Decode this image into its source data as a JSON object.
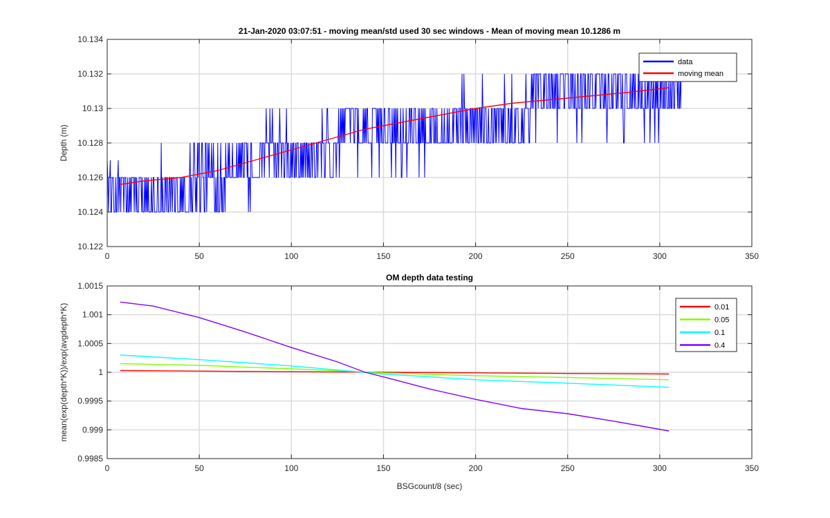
{
  "colors": {
    "data": "#0000ff",
    "moving_mean": "#ff0000",
    "k_0_01": "#ff0000",
    "k_0_05": "#80ff00",
    "k_0_1": "#00ffff",
    "k_0_4": "#8000ff"
  },
  "chart_data": [
    {
      "type": "line",
      "title": "21-Jan-2020 03:07:51 - moving mean/std used 30 sec windows - Mean of moving mean 10.1286 m",
      "xlabel": "",
      "ylabel": "Depth (m)",
      "xlim": [
        0,
        350
      ],
      "ylim": [
        10.122,
        10.134
      ],
      "xticks": [
        0,
        50,
        100,
        150,
        200,
        250,
        300,
        350
      ],
      "xtick_labels": [
        "0",
        "50",
        "100",
        "150",
        "200",
        "250",
        "300",
        "350"
      ],
      "yticks": [
        10.122,
        10.124,
        10.126,
        10.128,
        10.13,
        10.132,
        10.134
      ],
      "ytick_labels": [
        "10.122",
        "10.124",
        "10.126",
        "10.128",
        "10.13",
        "10.132",
        "10.134"
      ],
      "grid": true,
      "legend": "top-right",
      "series": [
        {
          "name": "data",
          "style": "noisy-quantized",
          "x_range": [
            0,
            312
          ],
          "level_segments": [
            {
              "x": [
                0,
                10
              ],
              "levels": [
                10.124,
                10.126
              ],
              "outliers": [
                10.127
              ]
            },
            {
              "x": [
                10,
                45
              ],
              "levels": [
                10.124,
                10.126
              ],
              "outliers": [
                10.128
              ]
            },
            {
              "x": [
                45,
                65
              ],
              "levels": [
                10.124,
                10.126,
                10.128
              ],
              "outliers": []
            },
            {
              "x": [
                65,
                85
              ],
              "levels": [
                10.126,
                10.128
              ],
              "outliers": [
                10.124
              ]
            },
            {
              "x": [
                85,
                125
              ],
              "levels": [
                10.126,
                10.128
              ],
              "outliers": [
                10.13
              ]
            },
            {
              "x": [
                125,
                175
              ],
              "levels": [
                10.128,
                10.13
              ],
              "outliers": [
                10.126
              ]
            },
            {
              "x": [
                175,
                230
              ],
              "levels": [
                10.128,
                10.13
              ],
              "outliers": [
                10.132
              ]
            },
            {
              "x": [
                230,
                312
              ],
              "levels": [
                10.13,
                10.132
              ],
              "outliers": [
                10.128
              ]
            }
          ]
        },
        {
          "name": "moving mean",
          "x": [
            7,
            20,
            40,
            60,
            80,
            100,
            120,
            140,
            160,
            180,
            200,
            220,
            240,
            260,
            280,
            305
          ],
          "values": [
            10.1256,
            10.1258,
            10.126,
            10.1264,
            10.127,
            10.1276,
            10.1282,
            10.1288,
            10.1292,
            10.1296,
            10.13,
            10.1303,
            10.1305,
            10.1307,
            10.1309,
            10.1312
          ]
        }
      ]
    },
    {
      "type": "line",
      "title": "OM depth data testing",
      "xlabel": "BSGcount/8 (sec)",
      "ylabel": "mean(exp(depth*K))/exp(avgdepth*K)",
      "xlim": [
        0,
        350
      ],
      "ylim": [
        0.9985,
        1.0015
      ],
      "xticks": [
        0,
        50,
        100,
        150,
        200,
        250,
        300,
        350
      ],
      "xtick_labels": [
        "0",
        "50",
        "100",
        "150",
        "200",
        "250",
        "300",
        "350"
      ],
      "yticks": [
        0.9985,
        0.999,
        0.9995,
        1,
        1.0005,
        1.001,
        1.0015
      ],
      "ytick_labels": [
        "0.9985",
        "0.999",
        "0.9995",
        "1",
        "1.0005",
        "1.001",
        "1.0015"
      ],
      "grid": true,
      "legend": "top-right",
      "series": [
        {
          "name": "0.01",
          "x": [
            7,
            50,
            100,
            150,
            200,
            250,
            305
          ],
          "values": [
            1.00003,
            1.00002,
            1.00001,
            1.0,
            0.99999,
            0.99998,
            0.99997
          ]
        },
        {
          "name": "0.05",
          "x": [
            7,
            50,
            100,
            150,
            200,
            250,
            305
          ],
          "values": [
            1.00015,
            1.00012,
            1.00006,
            0.99999,
            0.99994,
            0.99991,
            0.99987
          ]
        },
        {
          "name": "0.1",
          "x": [
            7,
            50,
            100,
            150,
            200,
            250,
            305
          ],
          "values": [
            1.0003,
            1.00022,
            1.00011,
            0.99997,
            0.99987,
            0.99981,
            0.99974
          ]
        },
        {
          "name": "0.4",
          "x": [
            7,
            25,
            50,
            75,
            100,
            125,
            140,
            150,
            175,
            200,
            225,
            250,
            275,
            305
          ],
          "values": [
            1.00122,
            1.00115,
            1.00095,
            1.0007,
            1.00043,
            1.00018,
            1.0,
            0.99992,
            0.99971,
            0.99953,
            0.99937,
            0.99928,
            0.99915,
            0.99898
          ]
        }
      ]
    }
  ]
}
